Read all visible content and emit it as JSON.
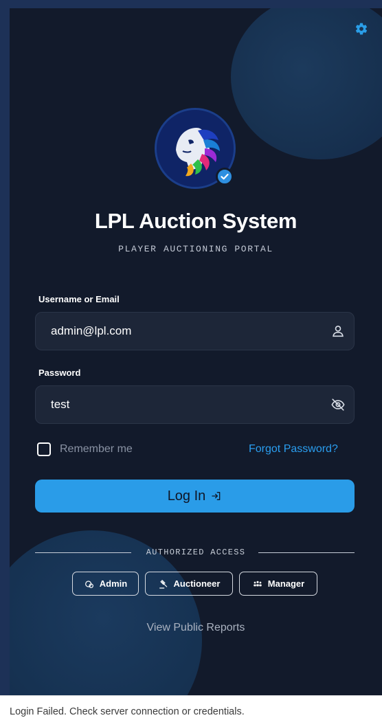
{
  "app": {
    "title": "LPL Auction System",
    "subtitle": "PLAYER AUCTIONING PORTAL"
  },
  "form": {
    "username_label": "Username or Email",
    "username_value": "admin@lpl.com",
    "password_label": "Password",
    "password_value": "test",
    "remember_label": "Remember me",
    "remember_checked": false,
    "forgot_label": "Forgot Password?",
    "login_label": "Log In"
  },
  "access": {
    "label": "AUTHORIZED ACCESS",
    "roles": [
      {
        "label": "Admin",
        "icon": "shield-user-icon"
      },
      {
        "label": "Auctioneer",
        "icon": "gavel-icon"
      },
      {
        "label": "Manager",
        "icon": "team-icon"
      }
    ]
  },
  "public_reports_label": "View Public Reports",
  "toast": {
    "message": "Login Failed. Check server connection or credentials."
  },
  "icons": {
    "settings": "gear-icon",
    "username": "user-icon",
    "password": "eye-off-icon",
    "login": "login-arrow-icon",
    "verified": "check-badge-icon",
    "logo": "lion-logo-icon"
  },
  "colors": {
    "accent": "#2a9ce8",
    "background": "#121a2b",
    "outer": "#1d3157",
    "input": "#1d2638"
  }
}
